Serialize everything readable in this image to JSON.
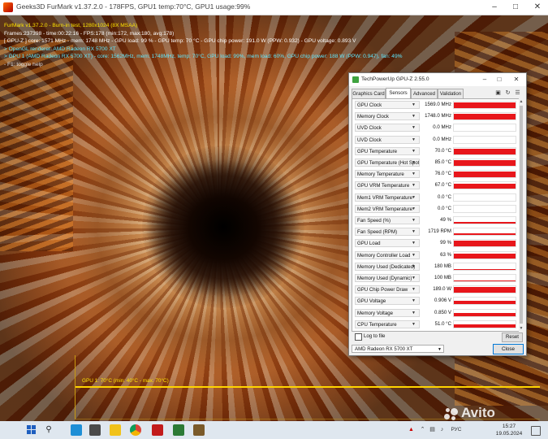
{
  "furmark": {
    "title": "Geeks3D FurMark v1.37.2.0 - 178FPS, GPU1 temp:70°C, GPU1 usage:99%",
    "overlay": {
      "line1": "FurMark v1.37.2.0 - Burn-in test, 1280x1024 (8X MSAA)",
      "line2": "Frames:237398 - time:00:22:16 - FPS:178 (min:172, max:180, avg:178)",
      "line3": "[ GPU-Z ] core: 1571 MHz - mem: 1748 MHz - GPU load: 99 % - GPU temp: 70 °C - GPU chip power: 191.0 W (PPW: 0.932) - GPU voltage: 0.893 V",
      "line4": "> OpenGL renderer: AMD Radeon RX 5700 XT",
      "line5": "> GPU 1 (AMD Radeon RX 5700 XT) - core: 1562MHz, mem: 1748MHz, temp: 70°C, GPU load: 99%, mem load: 60%, GPU chip power: 188 W (PPW: 0.947), fan: 49%",
      "line6": "- F1: toggle help"
    },
    "graph_label": "GPU 1: 70°C (min: 40°C - max: 70°C)"
  },
  "gpuz": {
    "title": "TechPowerUp GPU-Z 2.55.0",
    "tabs": [
      {
        "label": "Graphics Card",
        "active": false
      },
      {
        "label": "Sensors",
        "active": true
      },
      {
        "label": "Advanced",
        "active": false
      },
      {
        "label": "Validation",
        "active": false
      }
    ],
    "sensors": [
      {
        "name": "GPU Clock",
        "value": "1569.0 MHz",
        "level": 0.85
      },
      {
        "name": "Memory Clock",
        "value": "1748.0 MHz",
        "level": 0.85
      },
      {
        "name": "UVD Clock",
        "value": "0.0 MHz",
        "level": 0
      },
      {
        "name": "UVD Clock",
        "value": "0.0 MHz",
        "level": 0
      },
      {
        "name": "GPU Temperature",
        "value": "70.0 °C",
        "level": 0.85
      },
      {
        "name": "GPU Temperature (Hot Spot)",
        "value": "85.0 °C",
        "level": 0.85
      },
      {
        "name": "Memory Temperature",
        "value": "76.0 °C",
        "level": 0.85
      },
      {
        "name": "GPU VRM Temperature",
        "value": "67.0 °C",
        "level": 0.85
      },
      {
        "name": "Mem1 VRM Temperature",
        "value": "0.0 °C",
        "level": 0
      },
      {
        "name": "Mem2 VRM Temperature",
        "value": "0.0 °C",
        "level": 0
      },
      {
        "name": "Fan Speed (%)",
        "value": "49 %",
        "level": 0.3
      },
      {
        "name": "Fan Speed (RPM)",
        "value": "1719 RPM",
        "level": 0.3
      },
      {
        "name": "GPU Load",
        "value": "99 %",
        "level": 0.9
      },
      {
        "name": "Memory Controller Load",
        "value": "63 %",
        "level": 0.75
      },
      {
        "name": "Memory Used (Dedicated)",
        "value": "180 MB",
        "level": 0.1
      },
      {
        "name": "Memory Used (Dynamic)",
        "value": "100 MB",
        "level": 0.1
      },
      {
        "name": "GPU Chip Power Draw",
        "value": "189.0 W",
        "level": 0.85
      },
      {
        "name": "GPU Voltage",
        "value": "0.906 V",
        "level": 0.5
      },
      {
        "name": "Memory Voltage",
        "value": "0.850 V",
        "level": 0.5
      },
      {
        "name": "CPU Temperature",
        "value": "51.0 °C",
        "level": 0.5
      }
    ],
    "log_label": "Log to file",
    "reset_label": "Reset",
    "device": "AMD Radeon RX 5700 XT",
    "close_label": "Close"
  },
  "taskbar": {
    "language": "РУС",
    "time": "15:27",
    "date": "19.05.2024"
  },
  "watermark": "Avito",
  "colors": {
    "sensor_bar": "#e8161b",
    "overlay_yellow": "#ffe600",
    "overlay_cyan": "#5ee8ff",
    "overlay_green": "#7cff5a"
  }
}
